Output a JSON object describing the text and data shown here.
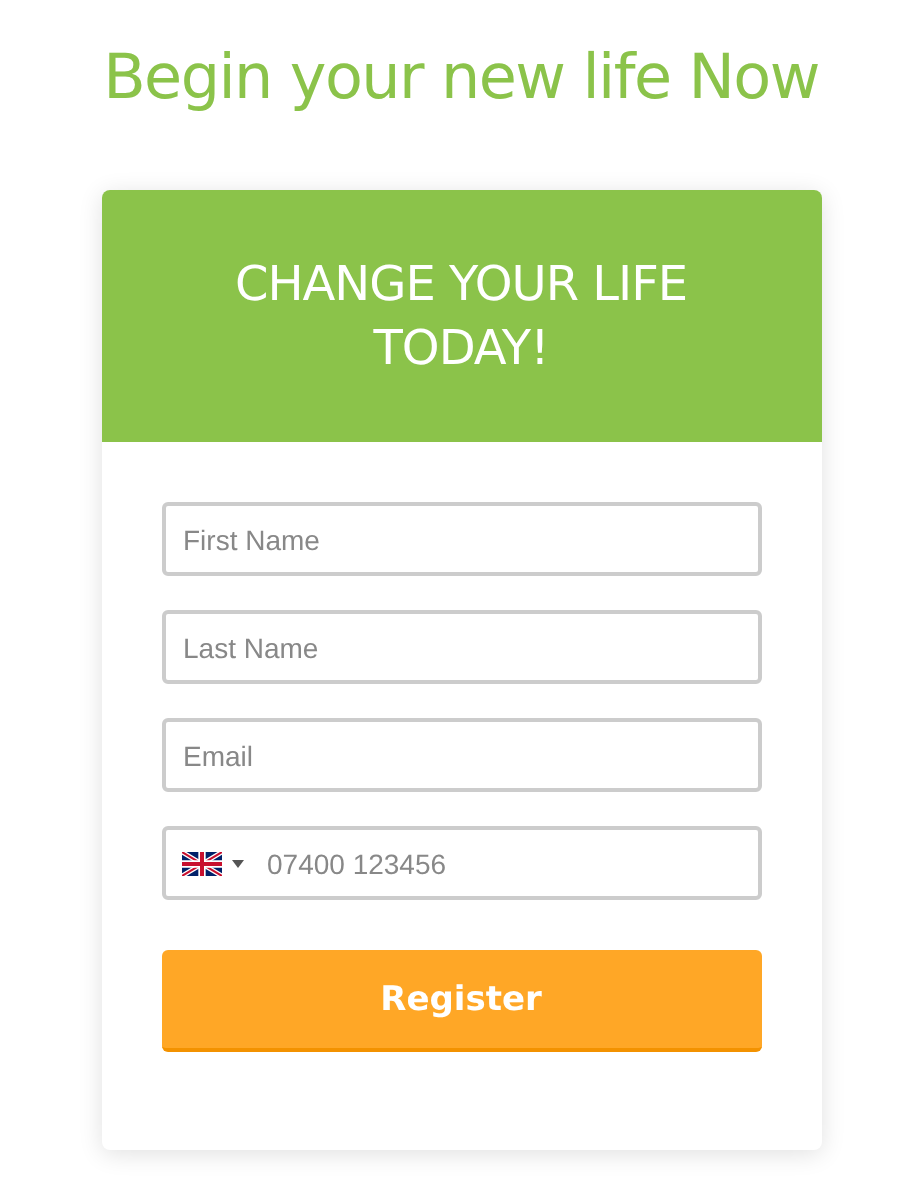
{
  "headline": "Begin your new life Now",
  "card": {
    "title": "CHANGE YOUR LIFE TODAY!",
    "fields": [
      {
        "kind": "text",
        "placeholder": "First Name"
      },
      {
        "kind": "text",
        "placeholder": "Last Name"
      },
      {
        "kind": "text",
        "placeholder": "Email"
      },
      {
        "kind": "phone",
        "placeholder": "07400 123456"
      }
    ],
    "button": "Register"
  }
}
